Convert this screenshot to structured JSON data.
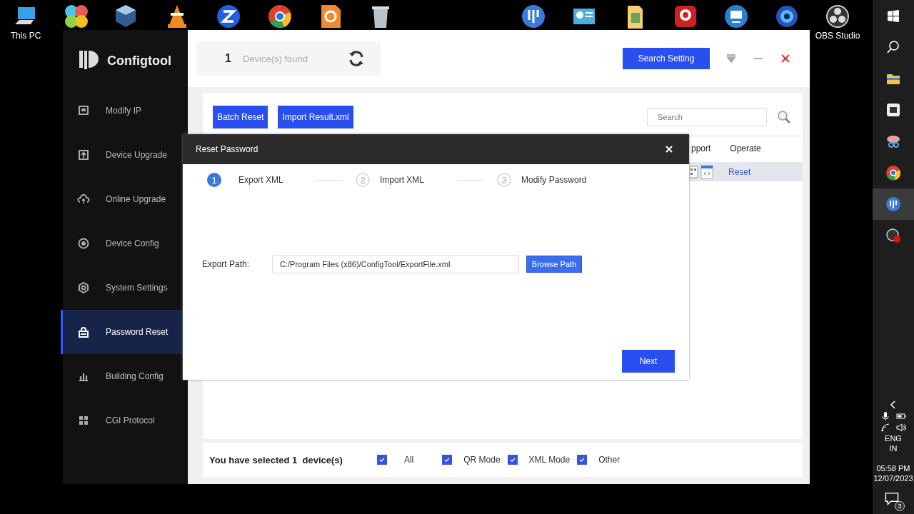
{
  "desktop": {
    "icons": [
      {
        "label": "This PC"
      },
      {
        "label": "OBS Studio"
      }
    ]
  },
  "app": {
    "title": "Configtool",
    "nav": [
      {
        "label": "Modify IP",
        "selected": false
      },
      {
        "label": "Device Upgrade",
        "selected": false
      },
      {
        "label": "Online Upgrade",
        "selected": false
      },
      {
        "label": "Device Config",
        "selected": false
      },
      {
        "label": "System Settings",
        "selected": false
      },
      {
        "label": "Password Reset",
        "selected": true
      },
      {
        "label": "Building Config",
        "selected": false
      },
      {
        "label": "CGI Protocol",
        "selected": false
      }
    ],
    "device_count": "1",
    "device_label": "Device(s) found",
    "search_setting": "Search Setting",
    "toolbar": {
      "buttons": [
        "Batch Reset",
        "Import Result.xml"
      ],
      "search": {
        "placeholder": "Search"
      }
    },
    "table": {
      "columns": [
        "pport",
        "Operate"
      ],
      "rows": [
        {
          "operate": "Reset",
          "selected": true
        }
      ]
    },
    "footer": {
      "summary": "You have selected 1  device(s)",
      "filters": [
        {
          "label": "All",
          "checked": true
        },
        {
          "label": "QR Mode",
          "checked": true
        },
        {
          "label": "XML Mode",
          "checked": true
        },
        {
          "label": "Other",
          "checked": true
        }
      ]
    }
  },
  "dialog": {
    "title": "Reset Password",
    "steps": [
      {
        "number": "1",
        "label": "Export XML",
        "selected": true
      },
      {
        "number": "2",
        "label": "Import XML",
        "selected": false
      },
      {
        "number": "3",
        "label": "Modify Password",
        "selected": false
      }
    ],
    "export_path": {
      "label": "Export Path:",
      "value": "C:/Program Files (x86)/ConfigTool/ExportFile.xml"
    },
    "browse_button": "Browse Path",
    "next_button": "Next"
  },
  "taskbar": {
    "language": "ENG",
    "region": "IN",
    "time": "05:58 PM",
    "date": "12/07/2023",
    "notifications": "3"
  }
}
